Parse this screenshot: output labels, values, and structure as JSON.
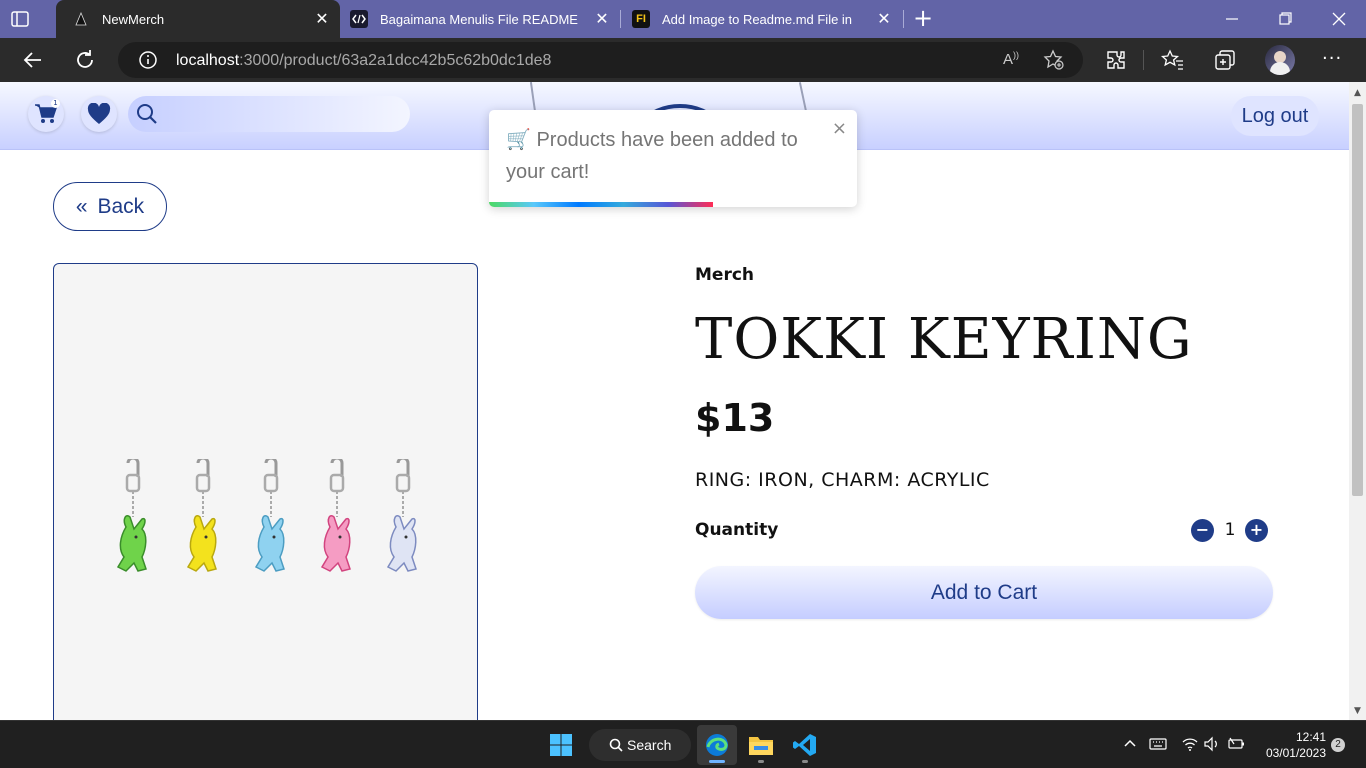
{
  "browser": {
    "tabs": [
      {
        "title": "NewMerch",
        "favicon": "merch-favicon",
        "active": true
      },
      {
        "title": "Bagaimana Menulis File README",
        "favicon": "code-favicon",
        "active": false
      },
      {
        "title": "Add Image to Readme.md File in",
        "favicon": "fi-favicon",
        "fav_text": "FI",
        "active": false
      }
    ],
    "url_host": "localhost",
    "url_rest": ":3000/product/63a2a1dcc42b5c62b0dc1de8"
  },
  "header": {
    "cart_badge": "1",
    "search_placeholder": "",
    "logout_label": "Log out"
  },
  "toast": {
    "icon": "🛒",
    "message": "Products have been added to your cart!",
    "close": "×",
    "progress": 0.61
  },
  "product": {
    "back_label": "Back",
    "back_icon": "«",
    "category": "Merch",
    "name": "TOKKI KEYRING",
    "price": "$13",
    "material": "RING: IRON, CHARM: ACRYLIC",
    "quantity_label": "Quantity",
    "quantity": "1",
    "minus": "−",
    "plus": "+",
    "add_to_cart": "Add to Cart",
    "keyring_colors": [
      "#6fd34a",
      "#f3e21d",
      "#8fd2f0",
      "#f59cc3",
      "#dfe4f4"
    ]
  },
  "taskbar": {
    "search_label": "Search",
    "time": "12:41",
    "date": "03/01/2023",
    "notifications": "2"
  },
  "colors": {
    "accent": "#1f3c88",
    "tabbar": "#6264a7",
    "chrome": "#2b2b2b"
  }
}
